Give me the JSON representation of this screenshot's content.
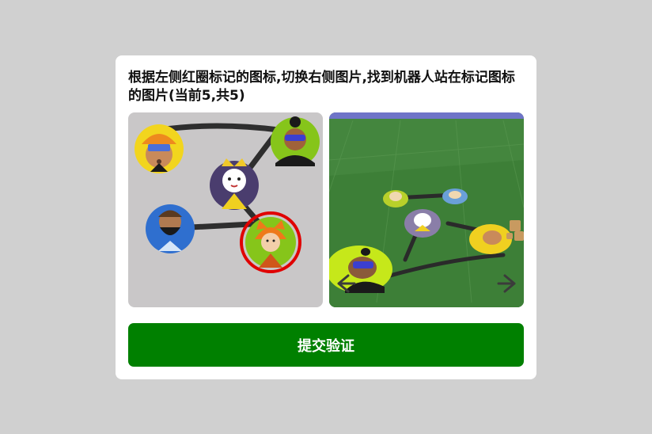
{
  "captcha": {
    "instruction": "根据左侧红圈标记的图标,切换右侧图片,找到机器人站在标记图标的图片(当前5,共5)",
    "current_image": 5,
    "total_images": 5,
    "submit_label": "提交验证"
  },
  "icons": {
    "prev": "arrow-left-icon",
    "next": "arrow-right-icon"
  },
  "colors": {
    "background": "#d0d0d0",
    "card": "#ffffff",
    "submit": "#008000",
    "highlight_ring": "#e00000"
  }
}
